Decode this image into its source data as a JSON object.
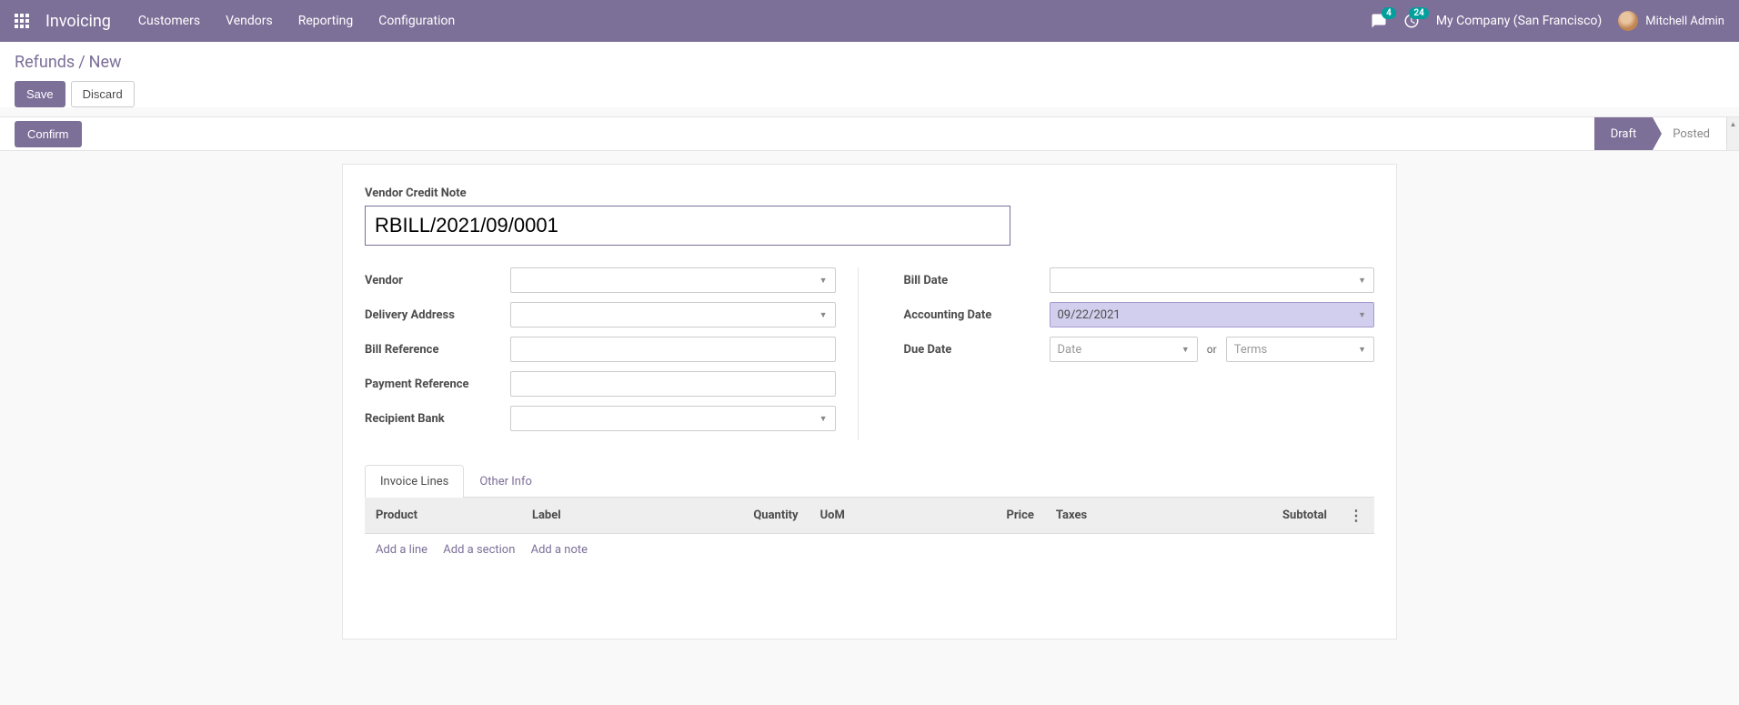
{
  "nav": {
    "app_title": "Invoicing",
    "menu": [
      "Customers",
      "Vendors",
      "Reporting",
      "Configuration"
    ],
    "messages_count": "4",
    "activities_count": "24",
    "company": "My Company (San Francisco)",
    "user": "Mitchell Admin"
  },
  "breadcrumb": {
    "parent": "Refunds",
    "current": "New"
  },
  "buttons": {
    "save": "Save",
    "discard": "Discard",
    "confirm": "Confirm"
  },
  "status": {
    "draft": "Draft",
    "posted": "Posted"
  },
  "form": {
    "title_label": "Vendor Credit Note",
    "title_value": "RBILL/2021/09/0001",
    "vendor_label": "Vendor",
    "delivery_label": "Delivery Address",
    "bill_ref_label": "Bill Reference",
    "pay_ref_label": "Payment Reference",
    "bank_label": "Recipient Bank",
    "bill_date_label": "Bill Date",
    "acc_date_label": "Accounting Date",
    "acc_date_value": "09/22/2021",
    "due_date_label": "Due Date",
    "due_date_placeholder": "Date",
    "or_text": "or",
    "terms_placeholder": "Terms"
  },
  "tabs": {
    "invoice_lines": "Invoice Lines",
    "other_info": "Other Info"
  },
  "table": {
    "headers": {
      "product": "Product",
      "label": "Label",
      "quantity": "Quantity",
      "uom": "UoM",
      "price": "Price",
      "taxes": "Taxes",
      "subtotal": "Subtotal"
    },
    "add_line": "Add a line",
    "add_section": "Add a section",
    "add_note": "Add a note"
  }
}
